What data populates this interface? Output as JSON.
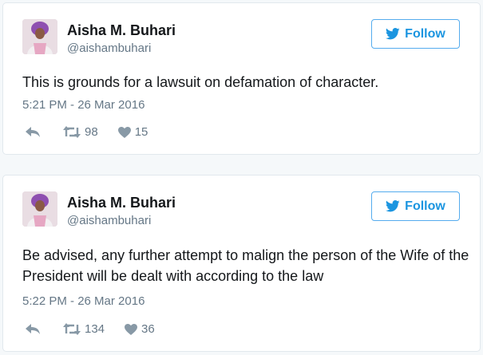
{
  "tweets": [
    {
      "name": "Aisha M. Buhari",
      "handle": "@aishambuhari",
      "follow_label": "Follow",
      "text": "This is grounds for a lawsuit on defamation of character.",
      "timestamp": "5:21 PM - 26 Mar 2016",
      "retweets": "98",
      "likes": "15"
    },
    {
      "name": "Aisha M. Buhari",
      "handle": "@aishambuhari",
      "follow_label": "Follow",
      "text": "Be advised, any further attempt to malign the person of the Wife of the President will be dealt with according to the law",
      "timestamp": "5:22 PM - 26 Mar 2016",
      "retweets": "134",
      "likes": "36"
    }
  ],
  "colors": {
    "accent": "#1b95e0",
    "muted": "#657786",
    "border": "#e1e8ed"
  },
  "icons": [
    "bird-icon",
    "reply-icon",
    "retweet-icon",
    "heart-icon"
  ]
}
